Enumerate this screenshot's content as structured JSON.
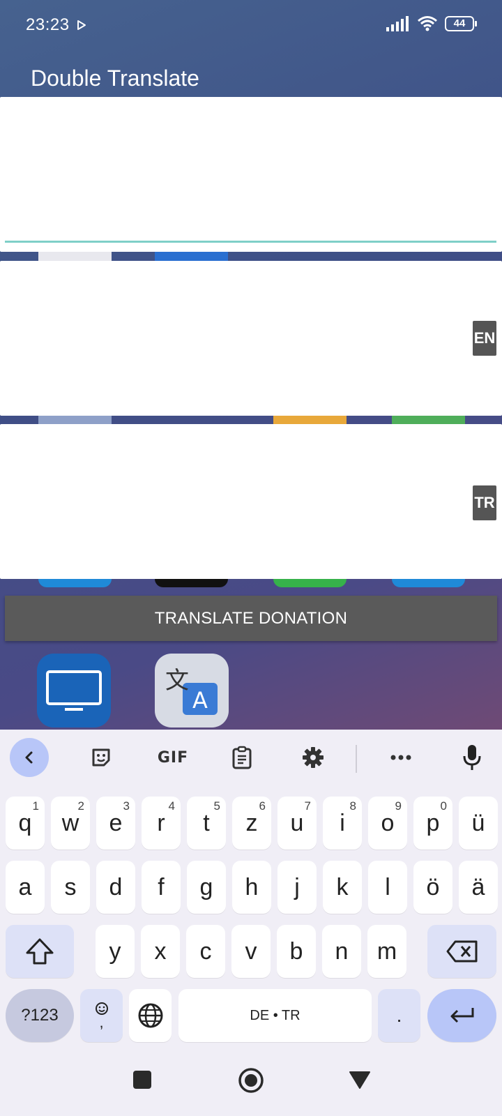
{
  "status_bar": {
    "time": "23:23",
    "battery": "44"
  },
  "app": {
    "title": "Double Translate"
  },
  "input_panel": {
    "text": ""
  },
  "output_panels": [
    {
      "lang": "EN",
      "text": ""
    },
    {
      "lang": "TR",
      "text": ""
    }
  ],
  "translate_button": {
    "label": "TRANSLATE DONATION"
  },
  "keyboard": {
    "toolbar": {
      "gif_label": "GIF"
    },
    "row1": [
      {
        "k": "q",
        "h": "1"
      },
      {
        "k": "w",
        "h": "2"
      },
      {
        "k": "e",
        "h": "3"
      },
      {
        "k": "r",
        "h": "4"
      },
      {
        "k": "t",
        "h": "5"
      },
      {
        "k": "z",
        "h": "6"
      },
      {
        "k": "u",
        "h": "7"
      },
      {
        "k": "i",
        "h": "8"
      },
      {
        "k": "o",
        "h": "9"
      },
      {
        "k": "p",
        "h": "0"
      },
      {
        "k": "ü",
        "h": ""
      }
    ],
    "row2": [
      "a",
      "s",
      "d",
      "f",
      "g",
      "h",
      "j",
      "k",
      "l",
      "ö",
      "ä"
    ],
    "row3": [
      "y",
      "x",
      "c",
      "v",
      "b",
      "n",
      "m"
    ],
    "mode_key": "?123",
    "comma_key": ",",
    "space_label": "DE • TR",
    "period_key": "."
  }
}
